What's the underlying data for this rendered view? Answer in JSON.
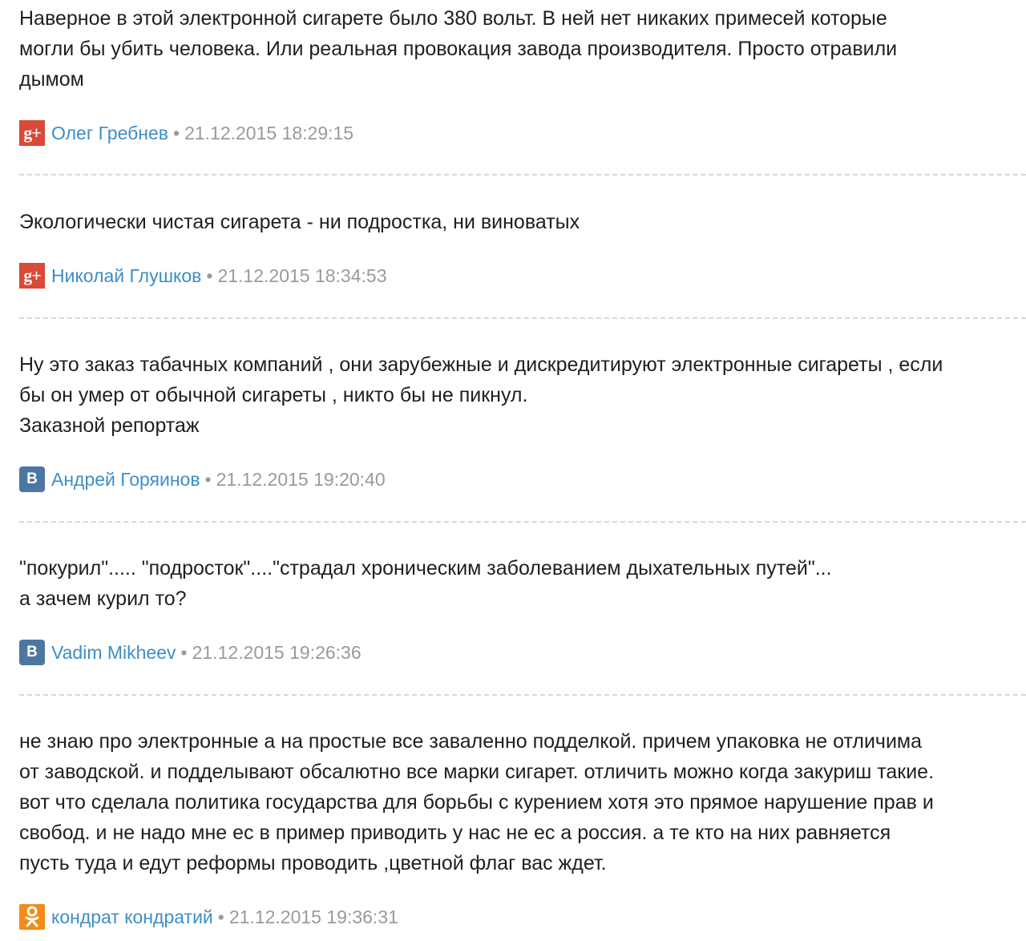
{
  "comments": [
    {
      "text": "Наверное в этой электронной сигарете было 380 вольт. В ней нет никаких примесей которые\nмогли бы убить человека. Или реальная провокация завода производителя. Просто отравили\nдымом",
      "icon": "google-plus-icon",
      "icon_glyph": "g+",
      "author": "Олег Гребнев",
      "separator": "•",
      "date": "21.12.2015 18:29:15"
    },
    {
      "text": "Экологически чистая сигарета - ни подростка, ни виноватых",
      "icon": "google-plus-icon",
      "icon_glyph": "g+",
      "author": "Николай Глушков",
      "separator": "•",
      "date": "21.12.2015 18:34:53"
    },
    {
      "text": "Ну это заказ табачных компаний , они зарубежные и дискредитируют электронные сигареты , если\nбы он умер от обычной сигареты , никто бы не пикнул.\nЗаказной репортаж",
      "icon": "vk-icon",
      "icon_glyph": "В",
      "author": "Андрей Горяинов",
      "separator": "•",
      "date": "21.12.2015 19:20:40"
    },
    {
      "text": "\"покурил\"..... \"подросток\"....\"страдал хроническим заболеванием дыхательных путей\"...\nа зачем курил то?",
      "icon": "vk-icon",
      "icon_glyph": "В",
      "author": "Vadim Mikheev",
      "separator": "•",
      "date": "21.12.2015 19:26:36"
    },
    {
      "text": "не знаю про электронные а на простые все заваленно подделкой. причем упаковка не отличима\nот заводской. и подделывают обсалютно все марки сигарет. отличить можно когда закуриш такие.\nвот что сделала политика государства для борьбы с курением хотя это прямое нарушение прав и\nсвобод. и не надо мне ес в пример приводить у нас не ес а россия. а те кто на них равняется\nпусть туда и едут реформы проводить ,цветной флаг вас ждет.",
      "icon": "odnoklassniki-icon",
      "icon_glyph": "",
      "author": "кондрат кондратий",
      "separator": "•",
      "date": "21.12.2015 19:36:31"
    }
  ],
  "colors": {
    "text": "#1f1f1f",
    "author_link": "#3d8ec7",
    "date": "#9a9a9a",
    "divider": "#d8d8d8",
    "google_plus": "#d94a38",
    "vk": "#4d76a1",
    "odnoklassniki": "#f28b19"
  }
}
